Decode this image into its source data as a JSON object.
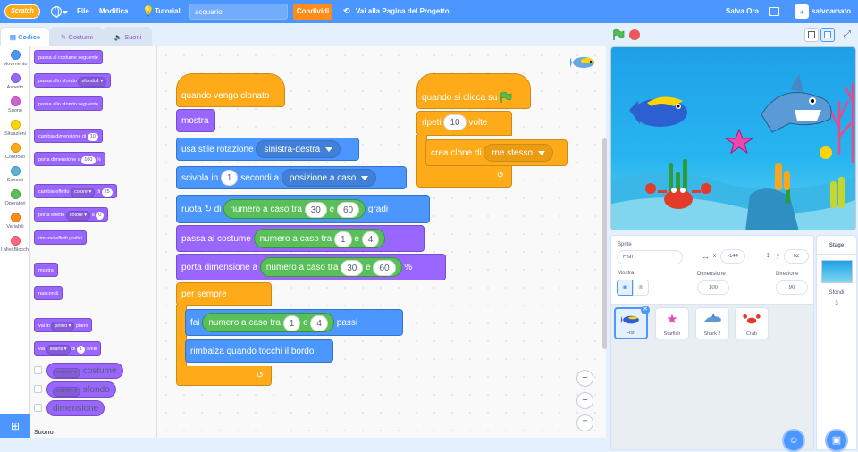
{
  "menubar": {
    "logo": "Scratch",
    "file": "File",
    "edit": "Modifica",
    "tutorial": "Tutorial",
    "project_title": "acquario",
    "share": "Condividi",
    "project_page": "Vai alla Pagina del Progetto",
    "save": "Salva Ora",
    "username": "salvoamato"
  },
  "tabs": {
    "code": "Codice",
    "costumes": "Costumi",
    "sounds": "Suoni"
  },
  "categories": [
    {
      "label": "Movimento",
      "color": "#4c97ff"
    },
    {
      "label": "Aspetto",
      "color": "#9966ff"
    },
    {
      "label": "Suono",
      "color": "#cf63cf"
    },
    {
      "label": "Situazioni",
      "color": "#ffd500"
    },
    {
      "label": "Controllo",
      "color": "#ffab19"
    },
    {
      "label": "Sensori",
      "color": "#5cb1d6"
    },
    {
      "label": "Operatori",
      "color": "#59c059"
    },
    {
      "label": "Variabili",
      "color": "#ff8c1a"
    },
    {
      "label": "I Miei Blocchi",
      "color": "#ff6680"
    }
  ],
  "palette": {
    "next_costume": "passa al costume seguente",
    "switch_backdrop": "passa allo sfondo",
    "backdrop_val": "sfondo1",
    "next_backdrop": "passa allo sfondo seguente",
    "change_size": "cambia dimensione di",
    "change_size_val": "10",
    "set_size": "porta dimensione a",
    "set_size_val": "100",
    "pct": "%",
    "change_effect": "cambia effetto",
    "effect_val": "colore",
    "by": "di",
    "change_effect_val": "25",
    "set_effect": "porta effetto",
    "to": "a",
    "set_effect_val": "0",
    "clear_effects": "rimuovi effetti grafici",
    "show": "mostra",
    "hide": "nascondi",
    "go_to": "vai in",
    "front_val": "primo",
    "layer_word": "piano",
    "go": "vai",
    "forward_val": "avanti",
    "of": "di",
    "layers_val": "1",
    "layers_word": "livelli",
    "rep_costume_dd": "numero",
    "rep_costume": "costume",
    "rep_backdrop_dd": "numero",
    "rep_backdrop": "sfondo",
    "rep_size": "dimensione",
    "sound_heading": "Suono"
  },
  "script1": {
    "hat": "quando vengo clonato",
    "show": "mostra",
    "rot_style": "usa stile rotazione",
    "rot_val": "sinistra-destra",
    "glide": "scivola in",
    "glide_secs": "1",
    "glide_secs_word": "secondi a",
    "glide_target": "posizione a caso",
    "turn": "ruota",
    "turn_icon": "↻",
    "turn_of": "di",
    "random": "numero a caso tra",
    "and": "e",
    "turn_a": "30",
    "turn_b": "60",
    "degrees": "gradi",
    "switch_costume": "passa al costume",
    "cost_a": "1",
    "cost_b": "4",
    "set_size": "porta dimensione a",
    "size_a": "30",
    "size_b": "60",
    "pct": "%",
    "forever": "per sempre",
    "move": "fai",
    "move_a": "1",
    "move_b": "4",
    "steps": "passi",
    "bounce": "rimbalza quando tocchi il bordo",
    "loop_arrow": "↺"
  },
  "script2": {
    "hat": "quando si clicca su",
    "repeat": "ripeti",
    "repeat_val": "10",
    "times": "volte",
    "clone": "crea clone di",
    "clone_val": "me stesso",
    "loop_arrow": "↺"
  },
  "zoom": {
    "in": "+",
    "out": "−",
    "reset": "="
  },
  "sprite_info": {
    "sprite_label": "Sprite",
    "sprite_name": "Fish",
    "x_label": "x",
    "x_val": "-144",
    "y_label": "y",
    "y_val": "62",
    "show_label": "Mostra",
    "size_label": "Dimensione",
    "size_val": "100",
    "dir_label": "Direzione",
    "dir_val": "90"
  },
  "sprites": [
    {
      "name": "Fish",
      "selected": true
    },
    {
      "name": "Starfish",
      "selected": false
    },
    {
      "name": "Shark 2",
      "selected": false
    },
    {
      "name": "Crab",
      "selected": false
    }
  ],
  "stage_panel": {
    "title": "Stage",
    "backdrops_label": "Sfondi",
    "backdrops_count": "3"
  }
}
